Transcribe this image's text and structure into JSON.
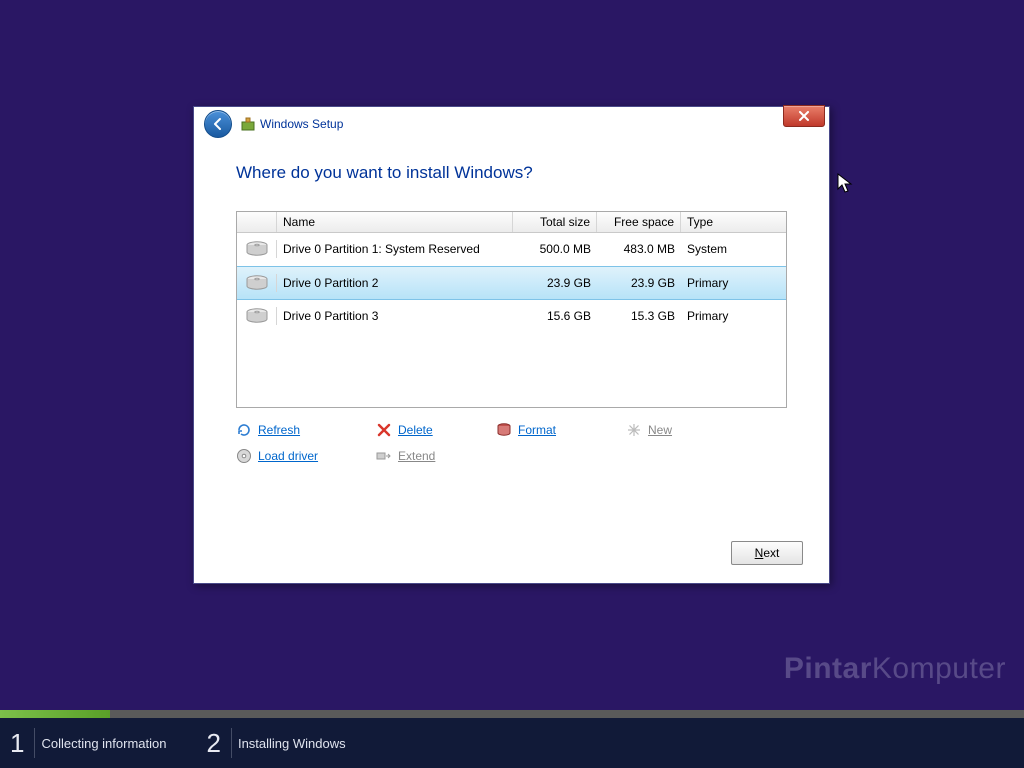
{
  "window": {
    "title": "Windows Setup"
  },
  "heading": "Where do you want to install Windows?",
  "columns": {
    "name": "Name",
    "total": "Total size",
    "free": "Free space",
    "type": "Type"
  },
  "partitions": [
    {
      "name": "Drive 0 Partition 1: System Reserved",
      "total": "500.0 MB",
      "free": "483.0 MB",
      "type": "System",
      "selected": false
    },
    {
      "name": "Drive 0 Partition 2",
      "total": "23.9 GB",
      "free": "23.9 GB",
      "type": "Primary",
      "selected": true
    },
    {
      "name": "Drive 0 Partition 3",
      "total": "15.6 GB",
      "free": "15.3 GB",
      "type": "Primary",
      "selected": false
    }
  ],
  "actions": {
    "refresh": "Refresh",
    "delete": "Delete",
    "format": "Format",
    "new": "New",
    "load_driver": "Load driver",
    "extend": "Extend"
  },
  "next": "Next",
  "watermark": {
    "a": "Pintar",
    "b": "Komputer"
  },
  "steps": {
    "s1": "Collecting information",
    "s2": "Installing Windows"
  }
}
